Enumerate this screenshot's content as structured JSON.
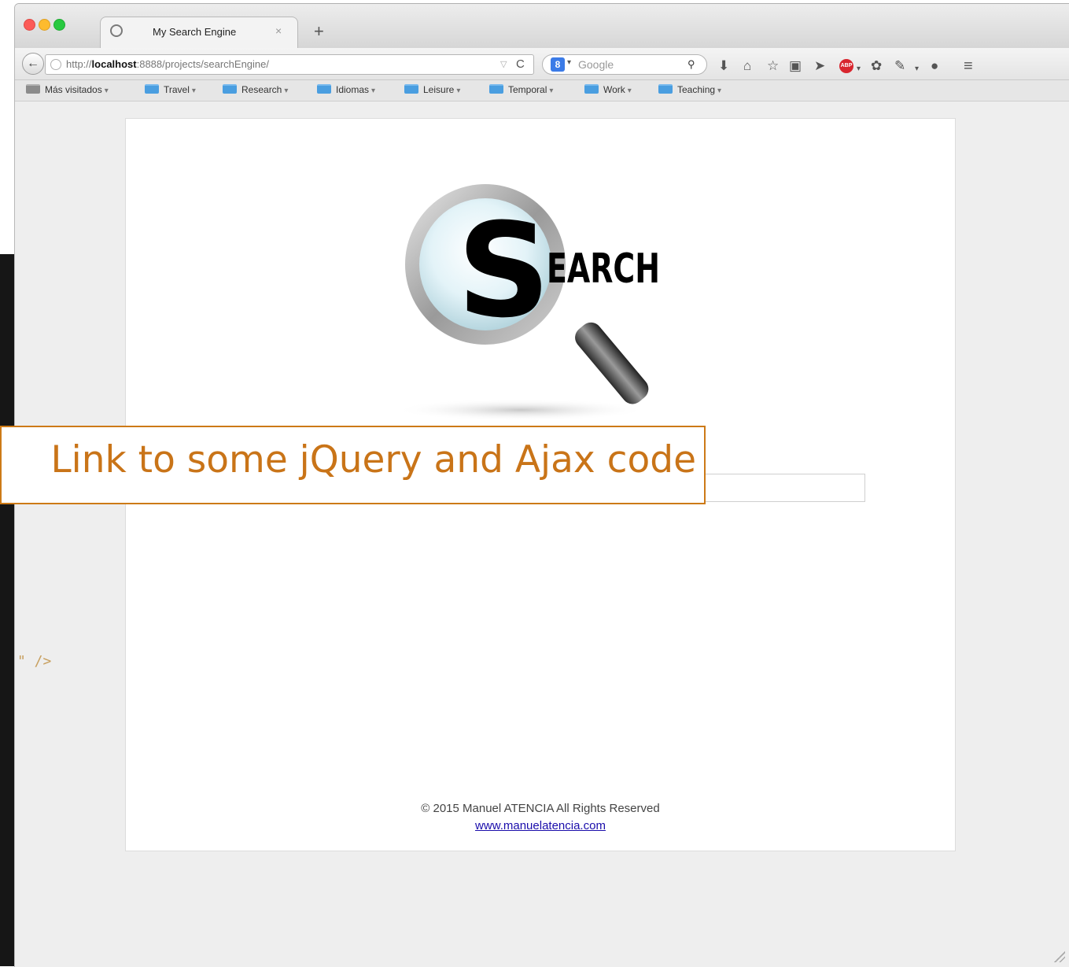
{
  "window": {
    "tab_title": "My Search Engine",
    "tab_close": "×",
    "new_tab": "+"
  },
  "navbar": {
    "back_icon": "←",
    "url_prefix": "http://",
    "url_host": "localhost",
    "url_rest": ":8888/projects/searchEngine/",
    "url_filter_icon": "▽",
    "reload_icon": "C",
    "search_engine_logo": "8",
    "search_placeholder": "Google",
    "search_icon": "🔍",
    "toolbar_icons": [
      "download-icon",
      "home-icon",
      "star-icon",
      "clipboard-icon",
      "send-icon",
      "adblock-icon",
      "addon-icon",
      "pocket-icon",
      "chat-icon",
      "menu-icon"
    ],
    "adblock_label": "ABP"
  },
  "bookmarks": [
    {
      "label": "Más visitados",
      "icon": "gray-folder-icon"
    },
    {
      "label": "Travel",
      "icon": "folder-icon"
    },
    {
      "label": "Research",
      "icon": "folder-icon"
    },
    {
      "label": "Idiomas",
      "icon": "folder-icon"
    },
    {
      "label": "Leisure",
      "icon": "folder-icon"
    },
    {
      "label": "Temporal",
      "icon": "folder-icon"
    },
    {
      "label": "Work",
      "icon": "folder-icon"
    },
    {
      "label": "Teaching",
      "icon": "folder-icon"
    }
  ],
  "page": {
    "logo_letter": "S",
    "logo_text": "EARCH",
    "search_value": "",
    "copyright": "© 2015 Manuel ATENCIA All Rights Reserved",
    "site_link": "www.manuelatencia.com"
  },
  "editor": {
    "visible_fragment": "\" />"
  },
  "callout": {
    "text": "Link to some jQuery and Ajax code"
  },
  "colors": {
    "callout_accent": "#c97418",
    "link": "#1a0dab"
  }
}
